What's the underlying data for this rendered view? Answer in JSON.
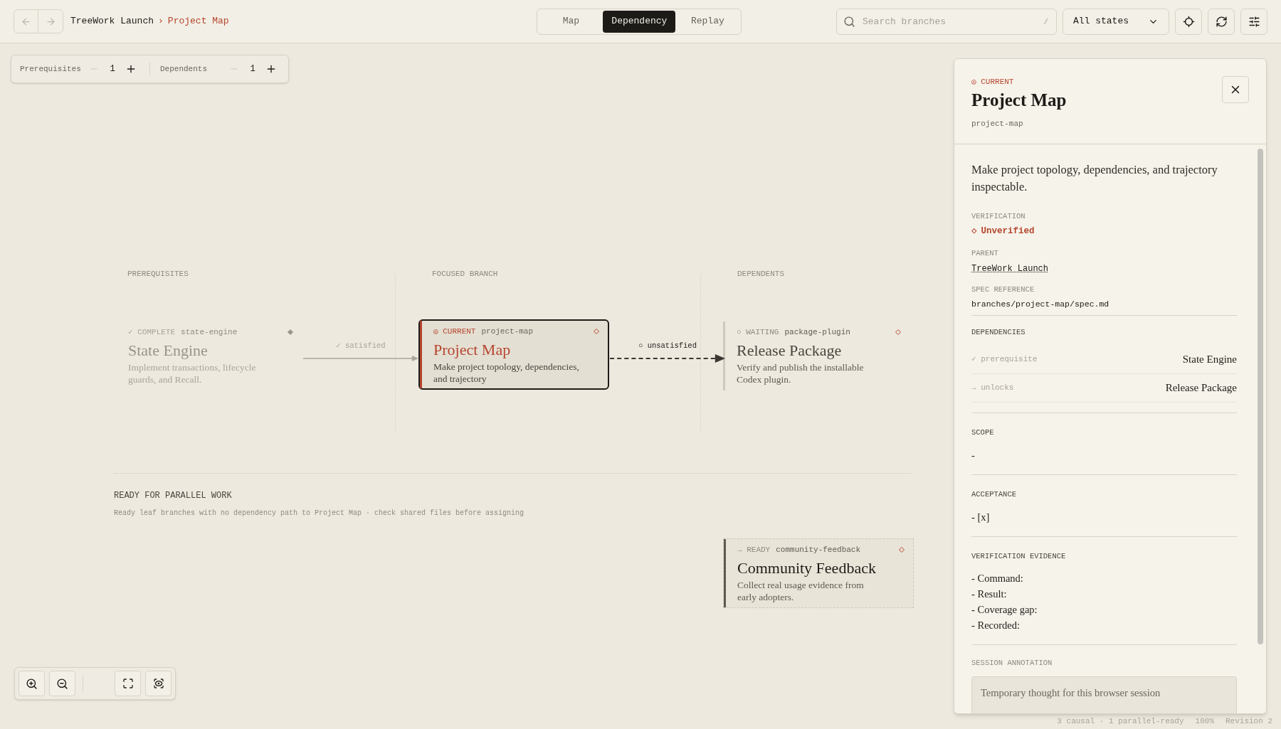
{
  "breadcrumb": {
    "parent": "TreeWork Launch",
    "separator": "›",
    "current": "Project Map"
  },
  "view_tabs": [
    {
      "label": "Map",
      "selected": false
    },
    {
      "label": "Dependency",
      "selected": true
    },
    {
      "label": "Replay",
      "selected": false
    }
  ],
  "search": {
    "placeholder": "Search branches",
    "shortcut": "/"
  },
  "state_filter": {
    "value": "All states"
  },
  "depth_controls": [
    {
      "label": "Prerequisites",
      "value": "1"
    },
    {
      "label": "Dependents",
      "value": "1"
    }
  ],
  "columns": [
    "PREREQUISITES",
    "FOCUSED BRANCH",
    "DEPENDENTS"
  ],
  "nodes": [
    {
      "kind": "complete",
      "status_icon": "✓",
      "status": "COMPLETE",
      "slug": "state-engine",
      "title": "State Engine",
      "description": "Implement transactions, lifecycle guards, and Recall."
    },
    {
      "kind": "current",
      "status_icon": "◎",
      "status": "CURRENT",
      "slug": "project-map",
      "title": "Project Map",
      "description": "Make project topology, dependencies, and trajectory"
    },
    {
      "kind": "waiting",
      "status_icon": "○",
      "status": "WAITING",
      "slug": "package-plugin",
      "title": "Release Package",
      "description": "Verify and publish the installable Codex plugin."
    }
  ],
  "edges": [
    {
      "kind": "satisfied",
      "label": "✓ satisfied"
    },
    {
      "kind": "unsatisfied",
      "label": "○ unsatisfied"
    }
  ],
  "parallel": {
    "title": "READY FOR PARALLEL WORK",
    "subtitle": "Ready leaf branches with no dependency path to Project Map · check shared files before assigning",
    "nodes": [
      {
        "kind": "ready",
        "status_icon": "→",
        "status": "READY",
        "slug": "community-feedback",
        "title": "Community Feedback",
        "description": "Collect real usage evidence from early adopters."
      }
    ]
  },
  "detail": {
    "status_icon": "◎",
    "status": "CURRENT",
    "title": "Project Map",
    "slug": "project-map",
    "description": "Make project topology, dependencies, and trajectory inspectable.",
    "verification_label": "VERIFICATION",
    "verification_icon": "◇",
    "verification": "Unverified",
    "parent_label": "PARENT",
    "parent": "TreeWork Launch",
    "spec_label": "SPEC REFERENCE",
    "spec": "branches/project-map/spec.md",
    "dependencies_label": "DEPENDENCIES",
    "dependencies": [
      {
        "icon": "✓",
        "relation": "prerequisite",
        "name": "State Engine"
      },
      {
        "icon": "→",
        "relation": "unlocks",
        "name": "Release Package"
      }
    ],
    "sections": [
      {
        "title": "SCOPE",
        "lines": [
          "-"
        ]
      },
      {
        "title": "ACCEPTANCE",
        "lines": [
          "- [x]"
        ]
      },
      {
        "title": "VERIFICATION EVIDENCE",
        "lines": [
          "- Command:",
          "- Result:",
          "- Coverage gap:",
          "- Recorded:"
        ]
      }
    ],
    "annotation_label": "SESSION ANNOTATION",
    "annotation_placeholder": "Temporary thought for this browser session"
  },
  "status_bar": [
    "3 causal · 1 parallel-ready",
    "100%",
    "Revision 2"
  ]
}
